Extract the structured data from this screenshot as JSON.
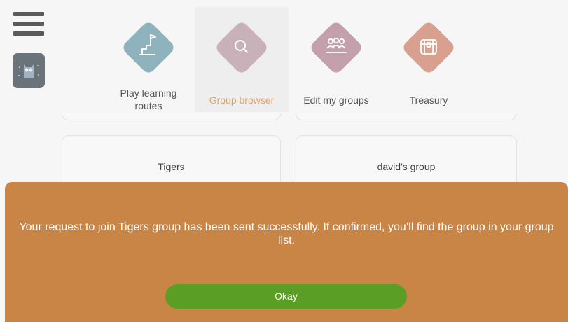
{
  "nav": {
    "items": [
      {
        "label_line1": "Play learning",
        "label_line2": "routes",
        "icon": "route-flag-icon",
        "color": "#8fb3bd"
      },
      {
        "label": "Group browser",
        "icon": "search-icon",
        "color": "#c9b1b9",
        "active": true
      },
      {
        "label": "Edit my groups",
        "icon": "people-group-icon",
        "color": "#c4a0ac"
      },
      {
        "label": "Treasury",
        "icon": "treasure-chest-icon",
        "color": "#d9a08f"
      }
    ]
  },
  "groups": {
    "cards": [
      {
        "name": "Tigers"
      },
      {
        "name": "david's group"
      }
    ]
  },
  "dialog": {
    "message": "Your request to join Tigers group has been sent successfully. If confirmed, you’ll find the group in your group list.",
    "okay_label": "Okay"
  },
  "colors": {
    "dialog_bg": "#c98545",
    "okay_button": "#5a9e26",
    "active_nav_text": "#e7a35a"
  }
}
